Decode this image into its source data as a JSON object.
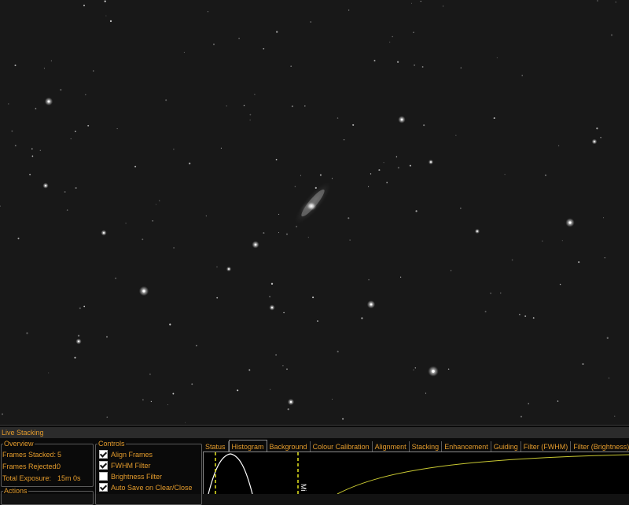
{
  "panel": {
    "title": "Live Stacking",
    "overview": {
      "legend": "Overview",
      "frames_stacked_label": "Frames Stacked:",
      "frames_stacked_value": "5",
      "frames_rejected_label": "Frames Rejected:",
      "frames_rejected_value": "0",
      "total_exposure_label": "Total Exposure:",
      "total_exposure_value": "15m 0s"
    },
    "actions": {
      "legend": "Actions"
    },
    "controls": {
      "legend": "Controls",
      "items": [
        {
          "label": "Align Frames",
          "checked": true
        },
        {
          "label": "FWHM Filter",
          "checked": true
        },
        {
          "label": "Brightness Filter",
          "checked": false
        },
        {
          "label": "Auto Save on Clear/Close",
          "checked": true
        }
      ]
    },
    "tabs": [
      {
        "label": "Status",
        "active": false
      },
      {
        "label": "Histogram",
        "active": true
      },
      {
        "label": "Background",
        "active": false
      },
      {
        "label": "Colour Calibration",
        "active": false
      },
      {
        "label": "Alignment",
        "active": false
      },
      {
        "label": "Stacking",
        "active": false
      },
      {
        "label": "Enhancement",
        "active": false
      },
      {
        "label": "Guiding",
        "active": false
      },
      {
        "label": "Filter (FWHM)",
        "active": false
      },
      {
        "label": "Filter (Brightness)",
        "active": false
      }
    ],
    "histogram": {
      "marker_label": "Mi"
    }
  },
  "colors": {
    "accent": "#e39b2c",
    "histogram_curve": "#ffffff",
    "stretch_curve": "#c8c832",
    "marker": "#e6e61e"
  }
}
